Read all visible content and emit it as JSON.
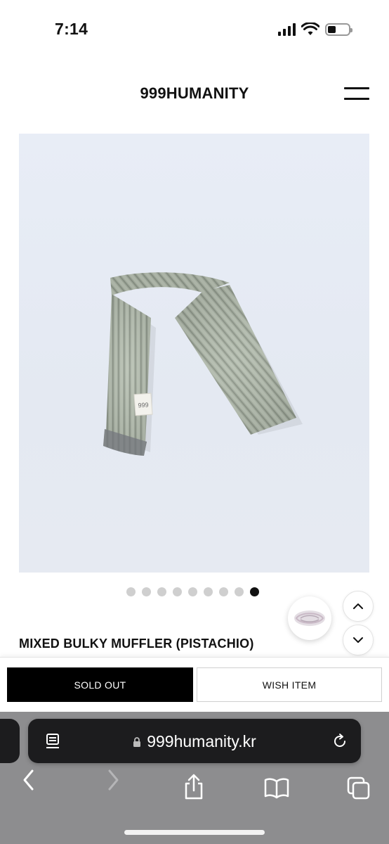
{
  "status_bar": {
    "time": "7:14",
    "icons": [
      "cellular-signal-icon",
      "wifi-icon",
      "battery-icon"
    ],
    "battery_level": 0.3
  },
  "header": {
    "brand": "999HUMANITY",
    "menu_icon": "hamburger-menu-icon"
  },
  "product": {
    "image_description_icon": "knit-scarf-photo",
    "carousel": {
      "total": 9,
      "active_index": 9
    },
    "title": "MIXED BULKY MUFFLER (PISTACHIO)"
  },
  "floating": {
    "thumbnail_icon": "scarf-thumbnail",
    "scroll_up_icon": "chevron-up-icon",
    "scroll_down_icon": "chevron-down-icon"
  },
  "actions": {
    "sold_out_label": "SOLD OUT",
    "wish_label": "WISH ITEM"
  },
  "browser": {
    "url": "999humanity.kr",
    "toolbar_icons": [
      "back-icon",
      "forward-icon",
      "share-icon",
      "bookmarks-icon",
      "tabs-icon"
    ]
  },
  "colors": {
    "brand_black": "#000000",
    "image_bg": "#e6ebf3",
    "scarf_green": "#a9b3a6",
    "chrome_gray": "#8d8d8f",
    "dot_inactive": "#cfcfcf"
  }
}
